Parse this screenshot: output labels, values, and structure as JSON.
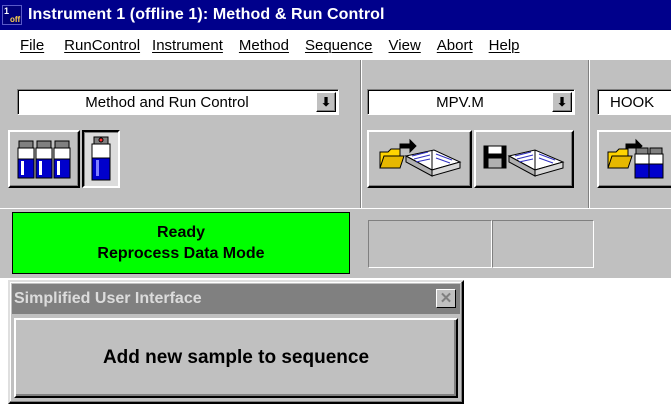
{
  "window": {
    "title": "Instrument 1 (offline 1): Method & Run Control",
    "icon": "instrument-app-icon",
    "icon_glyph_top": "1",
    "icon_glyph_bottom": "off"
  },
  "menu": {
    "items": [
      "File",
      "RunControl",
      "Instrument",
      "Method",
      "Sequence",
      "View",
      "Abort",
      "Help"
    ]
  },
  "toolbar": {
    "view_combo": {
      "value": "Method and Run Control",
      "dropdown_glyph": "⬇"
    },
    "method_combo": {
      "value": "MPV.M",
      "dropdown_glyph": "⬇"
    },
    "sequence_combo": {
      "value": "HOOK"
    },
    "buttons": [
      {
        "icon": "multiple-vials-icon",
        "pressed": false
      },
      {
        "icon": "single-vial-icon",
        "pressed": true
      },
      {
        "icon": "load-method-icon",
        "pressed": false
      },
      {
        "icon": "save-method-icon",
        "pressed": false
      },
      {
        "icon": "load-sequence-icon",
        "pressed": false
      }
    ]
  },
  "status": {
    "line1": "Ready",
    "line2": "Reprocess Data Mode",
    "color": "#00ff00"
  },
  "simplified_ui": {
    "title": "Simplified User Interface",
    "close_glyph": "✕",
    "button_label": "Add new sample to sequence"
  },
  "colors": {
    "titlebar": "#00008b",
    "face": "#c0c0c0",
    "inactive_caption": "#808080"
  }
}
